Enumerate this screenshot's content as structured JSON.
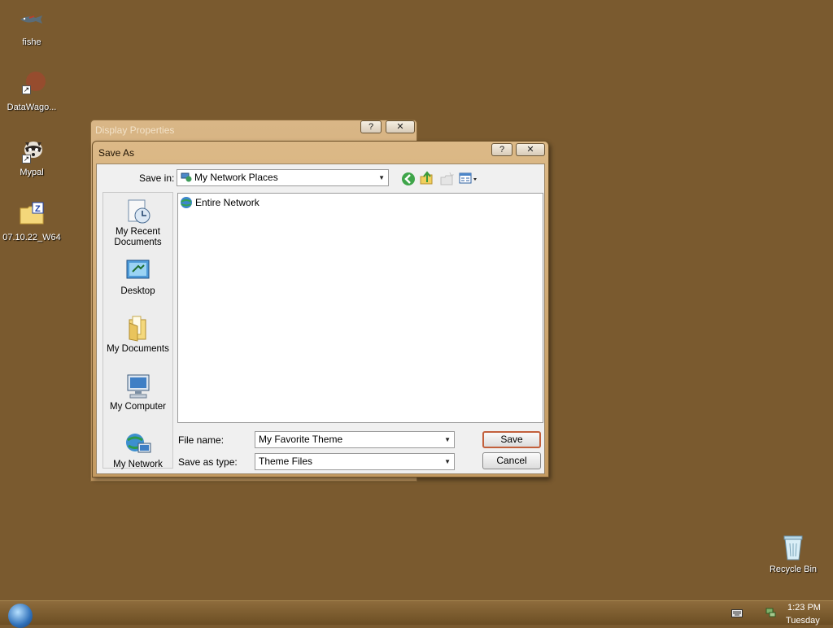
{
  "desktop": {
    "icons": [
      {
        "label": "fishe"
      },
      {
        "label": "DataWago..."
      },
      {
        "label": "Mypal"
      },
      {
        "label": "07.10.22_W64"
      },
      {
        "label": "Recycle Bin"
      }
    ]
  },
  "back_window": {
    "title": "Display Properties",
    "help_glyph": "?",
    "close_glyph": "✕"
  },
  "dialog": {
    "title": "Save As",
    "help_glyph": "?",
    "close_glyph": "✕",
    "save_in_label": "Save in:",
    "save_in_value": "My Network Places",
    "places": [
      {
        "label": "My Recent Documents",
        "icon": "recent-documents-icon"
      },
      {
        "label": "Desktop",
        "icon": "desktop-icon"
      },
      {
        "label": "My Documents",
        "icon": "my-documents-icon"
      },
      {
        "label": "My Computer",
        "icon": "my-computer-icon"
      },
      {
        "label": "My Network",
        "icon": "my-network-icon"
      }
    ],
    "files": [
      {
        "name": "Entire Network",
        "icon": "globe-icon"
      }
    ],
    "file_name_label": "File name:",
    "file_name_value": "My Favorite Theme",
    "save_type_label": "Save as type:",
    "save_type_value": "Theme Files",
    "save_button": "Save",
    "cancel_button": "Cancel"
  },
  "taskbar": {
    "time": "1:23 PM",
    "day": "Tuesday"
  },
  "colors": {
    "desktop": "#7a5a2f",
    "default_button_border": "#c2603c"
  }
}
